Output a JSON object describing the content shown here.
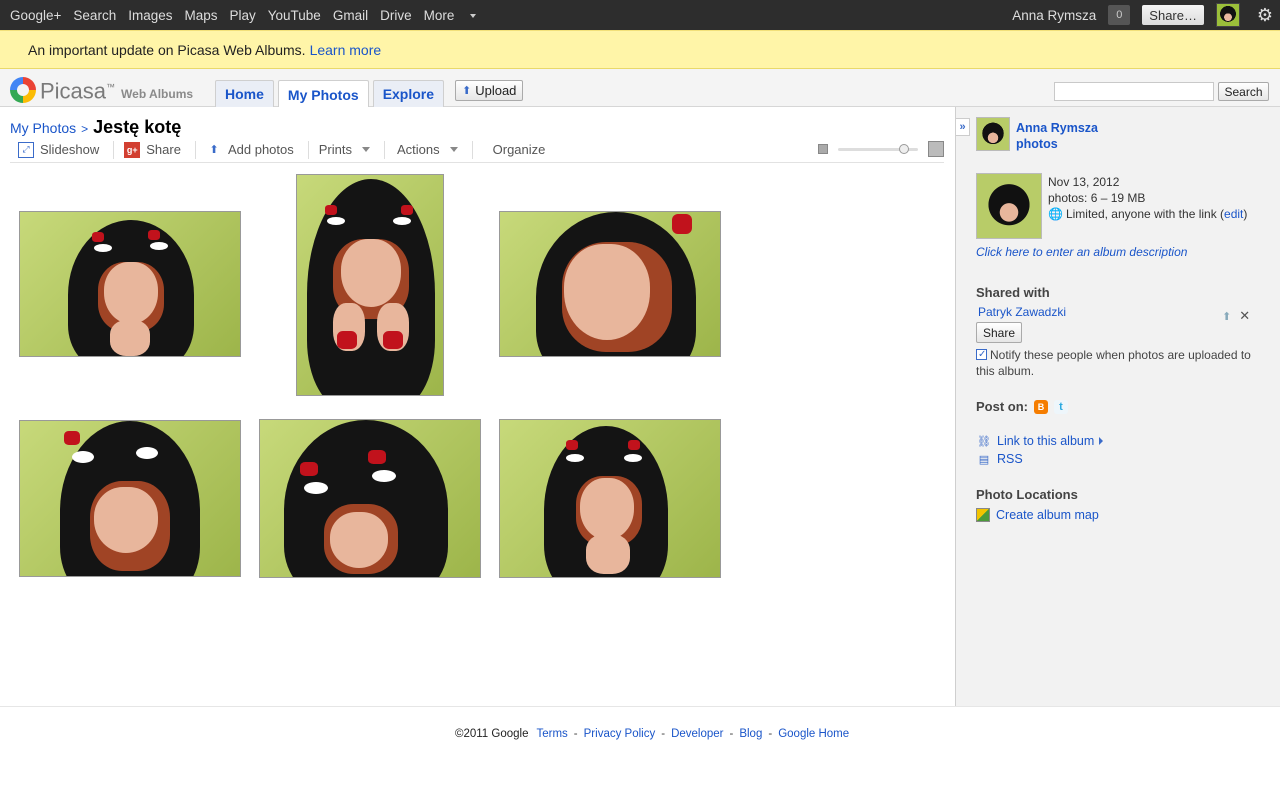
{
  "gbar": {
    "links": [
      "Google+",
      "Search",
      "Images",
      "Maps",
      "Play",
      "YouTube",
      "Gmail",
      "Drive",
      "More"
    ],
    "user": "Anna Rymsza",
    "notif_count": "0",
    "share_label": "Share…"
  },
  "notice": {
    "text": "An important update on Picasa Web Albums.",
    "link": "Learn more"
  },
  "header": {
    "logo": "Picasa",
    "logo_tm": "™",
    "logo_sub": "Web Albums",
    "tabs": [
      {
        "label": "Home"
      },
      {
        "label": "My Photos"
      },
      {
        "label": "Explore"
      }
    ],
    "upload_label": "Upload",
    "search_placeholder": "",
    "search_label": "Search"
  },
  "main": {
    "breadcrumb_link": "My Photos",
    "breadcrumb_sep": ">",
    "album_title": "Jestę kotę",
    "toolbar": {
      "slideshow": "Slideshow",
      "share": "Share",
      "add_photos": "Add photos",
      "prints": "Prints",
      "actions": "Actions",
      "organize": "Organize"
    },
    "zoom_level": 0.82,
    "photos_count": 6
  },
  "sidebar": {
    "owner_name": "Anna Rymsza",
    "owner_sub": "photos",
    "date": "Nov 13, 2012",
    "photos_info": "photos: 6 – 19 MB",
    "visibility": "Limited, anyone with the link",
    "edit_label": "edit",
    "description_link": "Click here to enter an album description",
    "shared_with_title": "Shared with",
    "shared_person": "Patryk Zawadzki",
    "share_button": "Share",
    "notify_text": "Notify these people when photos are uploaded to this album.",
    "post_on": "Post on:",
    "link_album": "Link to this album",
    "rss": "RSS",
    "photo_locations_title": "Photo Locations",
    "create_map": "Create album map"
  },
  "footer": {
    "copyright": "©2011 Google",
    "links": [
      "Terms",
      "Privacy Policy",
      "Developer",
      "Blog",
      "Google Home"
    ]
  }
}
